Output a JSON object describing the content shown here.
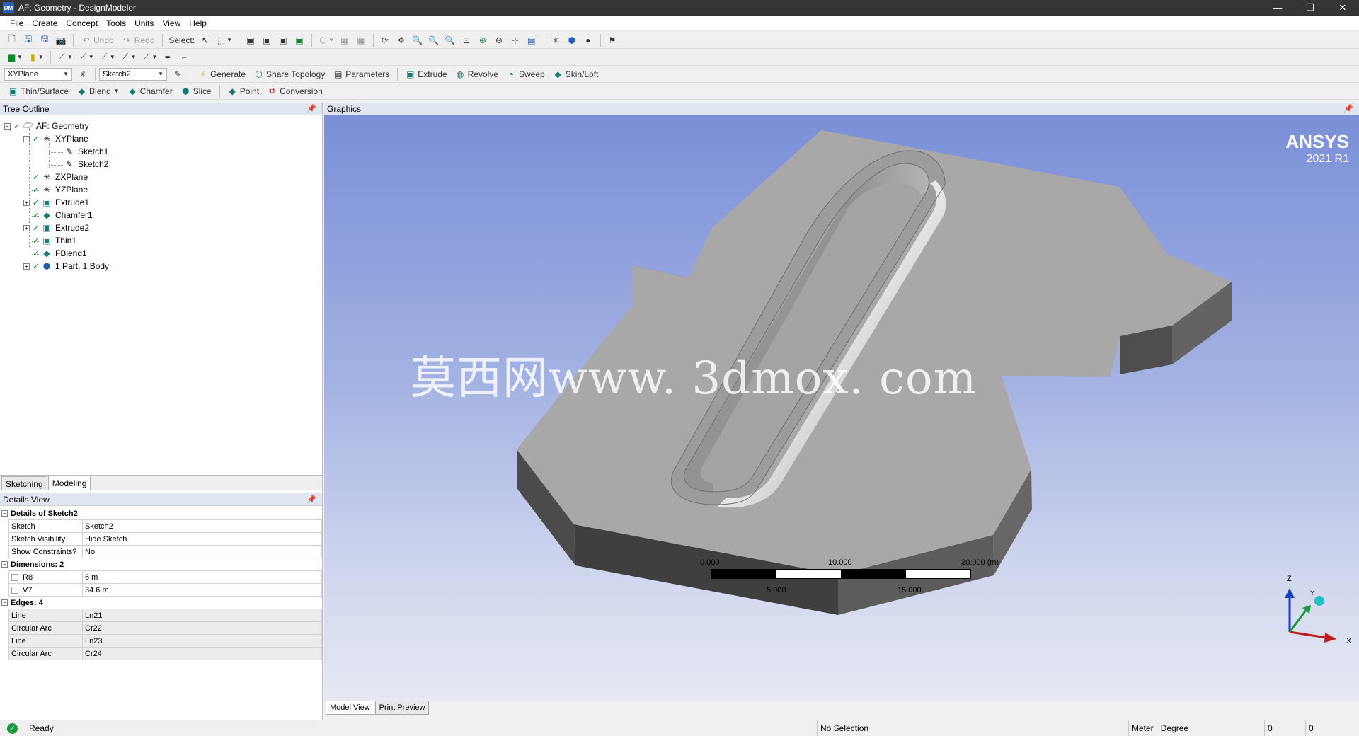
{
  "window": {
    "app_icon": "DM",
    "title": "AF: Geometry - DesignModeler",
    "controls": {
      "minimize": "—",
      "restore": "❐",
      "close": "✕"
    }
  },
  "menu": [
    "File",
    "Create",
    "Concept",
    "Tools",
    "Units",
    "View",
    "Help"
  ],
  "toolbar1": {
    "undo_label": "Undo",
    "redo_label": "Redo",
    "select_label": "Select:"
  },
  "toolbar3": {
    "plane_value": "XYPlane",
    "sketch_value": "Sketch2",
    "generate_label": "Generate",
    "share_topology_label": "Share Topology",
    "parameters_label": "Parameters",
    "extrude_label": "Extrude",
    "revolve_label": "Revolve",
    "sweep_label": "Sweep",
    "skin_loft_label": "Skin/Loft"
  },
  "toolbar4": {
    "thin_surface_label": "Thin/Surface",
    "blend_label": "Blend",
    "chamfer_label": "Chamfer",
    "slice_label": "Slice",
    "point_label": "Point",
    "conversion_label": "Conversion"
  },
  "tree": {
    "header": "Tree Outline",
    "root": "AF: Geometry",
    "xyplane": "XYPlane",
    "sketch1": "Sketch1",
    "sketch2": "Sketch2",
    "zxplane": "ZXPlane",
    "yzplane": "YZPlane",
    "extrude1": "Extrude1",
    "chamfer1": "Chamfer1",
    "extrude2": "Extrude2",
    "thin1": "Thin1",
    "fblend1": "FBlend1",
    "parts": "1 Part, 1 Body"
  },
  "panel_tabs": {
    "sketching": "Sketching",
    "modeling": "Modeling"
  },
  "details": {
    "header": "Details View",
    "group1": "Details of Sketch2",
    "sketch_key": "Sketch",
    "sketch_val": "Sketch2",
    "visibility_key": "Sketch Visibility",
    "visibility_val": "Hide Sketch",
    "constraints_key": "Show Constraints?",
    "constraints_val": "No",
    "group2": "Dimensions: 2",
    "r8_key": "R8",
    "r8_val": "6 m",
    "v7_key": "V7",
    "v7_val": "34.6 m",
    "group3": "Edges: 4",
    "edge1_key": "Line",
    "edge1_val": "Ln21",
    "edge2_key": "Circular Arc",
    "edge2_val": "Cr22",
    "edge3_key": "Line",
    "edge3_val": "Ln23",
    "edge4_key": "Circular Arc",
    "edge4_val": "Cr24"
  },
  "graphics": {
    "header": "Graphics",
    "logo_line1": "ANSYS",
    "logo_line2": "2021 R1",
    "watermark": "莫西网www. 3dmox. com",
    "triad": {
      "z": "Z",
      "y": "Y",
      "x": "X"
    },
    "scale": {
      "t0": "0.000",
      "t10": "10.000",
      "t20": "20.000 (m)",
      "t5": "5.000",
      "t15": "15.000"
    },
    "tabs": {
      "model_view": "Model View",
      "print_preview": "Print Preview"
    }
  },
  "status": {
    "ready": "Ready",
    "selection": "No Selection",
    "length_unit": "Meter",
    "angle_unit": "Degree",
    "field1": "0",
    "field2": "0"
  },
  "colors": {
    "title_bar": "#353535",
    "panel_header": "#dfe6ef",
    "viewport_top": "#7a8fd8",
    "viewport_bottom": "#e6e9f3",
    "body_gray": "#a7a7a7",
    "check_green": "#0a8a2a"
  }
}
